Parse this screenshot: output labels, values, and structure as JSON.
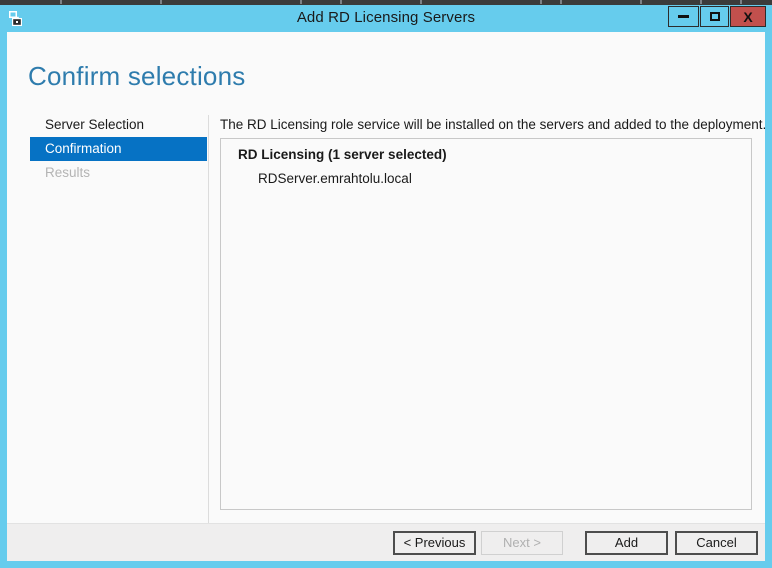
{
  "window": {
    "title": "Add RD Licensing Servers",
    "icon": "server-manager-icon",
    "controls": {
      "minimize_label": "–",
      "maximize_label": "□",
      "close_label": "X"
    },
    "colors": {
      "titlebar": "#66cced",
      "close_button": "#c2504d",
      "accent_selected": "#0672c4",
      "heading": "#2e7cad",
      "page_background": "#fafafa",
      "footer_background": "#efeeee"
    }
  },
  "page": {
    "heading": "Confirm selections"
  },
  "nav": {
    "items": [
      {
        "label": "Server Selection",
        "state": "normal"
      },
      {
        "label": "Confirmation",
        "state": "selected"
      },
      {
        "label": "Results",
        "state": "disabled"
      }
    ]
  },
  "main": {
    "description": "The RD Licensing role service will be installed on the servers and added to the deployment.",
    "role_group": {
      "title": "RD Licensing  (1 server selected)",
      "servers": [
        {
          "name": "RDServer.emrahtolu.local"
        }
      ]
    }
  },
  "footer": {
    "buttons": [
      {
        "label": "< Previous",
        "state": "default"
      },
      {
        "label": "Next >",
        "state": "disabled"
      },
      {
        "label": "Add",
        "state": "primary"
      },
      {
        "label": "Cancel",
        "state": "default"
      }
    ]
  }
}
